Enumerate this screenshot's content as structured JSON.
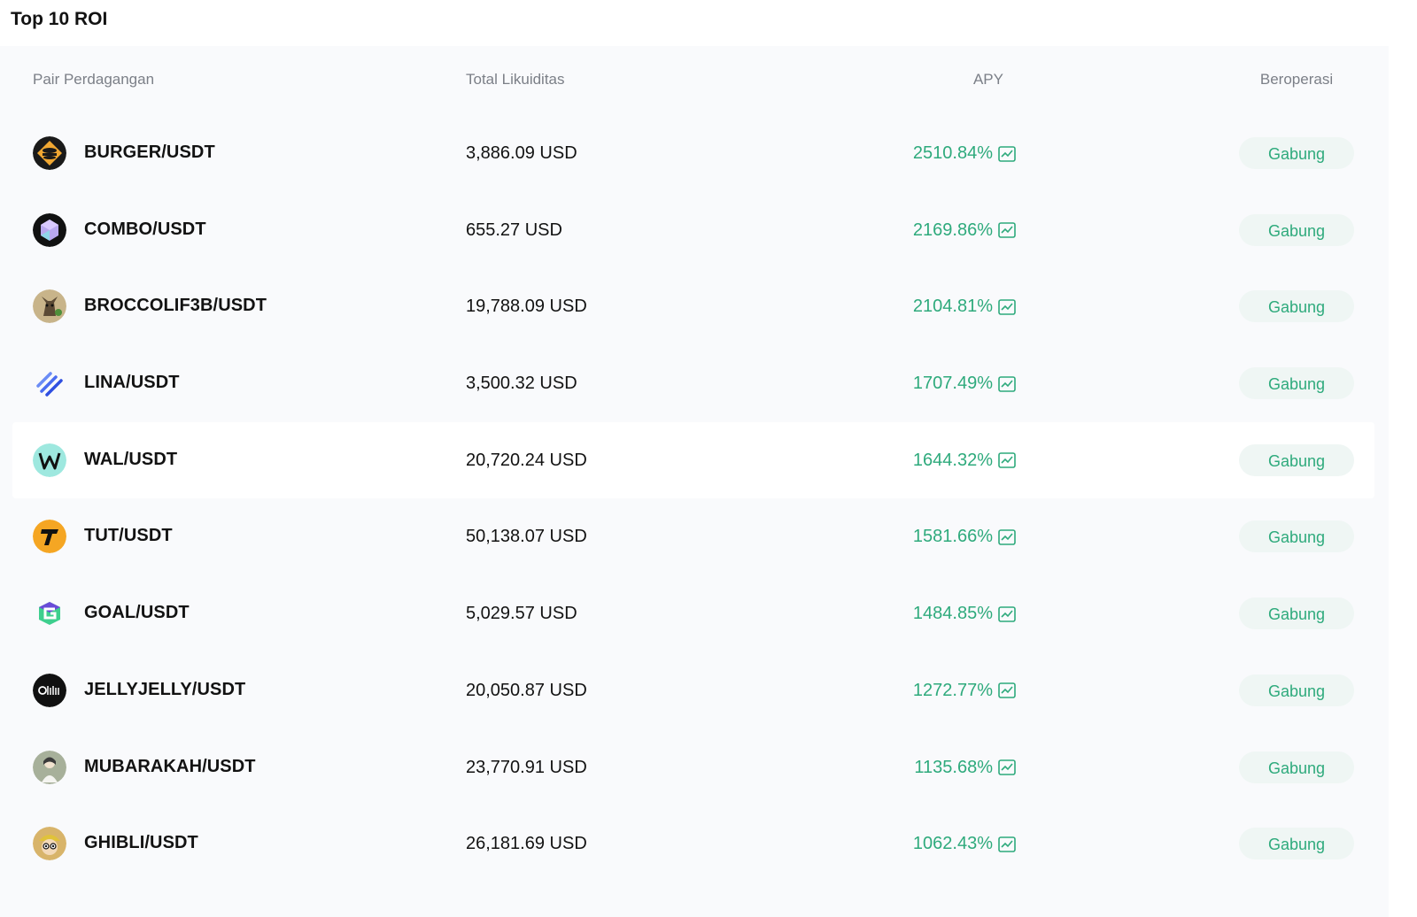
{
  "title": "Top 10 ROI",
  "headers": {
    "pair": "Pair Perdagangan",
    "liquidity": "Total Likuiditas",
    "apy": "APY",
    "operation": "Beroperasi"
  },
  "colors": {
    "accent_green": "#2eaa7c",
    "button_bg": "#eff6f4",
    "panel_bg": "#f9fafc"
  },
  "rows": [
    {
      "pair": "BURGER/USDT",
      "liquidity": "3,886.09 USD",
      "apy": "2510.84%",
      "action": "Gabung",
      "icon": "burger-coin-icon"
    },
    {
      "pair": "COMBO/USDT",
      "liquidity": "655.27 USD",
      "apy": "2169.86%",
      "action": "Gabung",
      "icon": "combo-coin-icon"
    },
    {
      "pair": "BROCCOLIF3B/USDT",
      "liquidity": "19,788.09 USD",
      "apy": "2104.81%",
      "action": "Gabung",
      "icon": "broccoli-dog-coin-icon"
    },
    {
      "pair": "LINA/USDT",
      "liquidity": "3,500.32 USD",
      "apy": "1707.49%",
      "action": "Gabung",
      "icon": "lina-coin-icon"
    },
    {
      "pair": "WAL/USDT",
      "liquidity": "20,720.24 USD",
      "apy": "1644.32%",
      "action": "Gabung",
      "icon": "wal-coin-icon"
    },
    {
      "pair": "TUT/USDT",
      "liquidity": "50,138.07 USD",
      "apy": "1581.66%",
      "action": "Gabung",
      "icon": "tut-coin-icon"
    },
    {
      "pair": "GOAL/USDT",
      "liquidity": "5,029.57 USD",
      "apy": "1484.85%",
      "action": "Gabung",
      "icon": "goal-coin-icon"
    },
    {
      "pair": "JELLYJELLY/USDT",
      "liquidity": "20,050.87 USD",
      "apy": "1272.77%",
      "action": "Gabung",
      "icon": "jelly-coin-icon"
    },
    {
      "pair": "MUBARAKAH/USDT",
      "liquidity": "23,770.91 USD",
      "apy": "1135.68%",
      "action": "Gabung",
      "icon": "mubarakah-coin-icon"
    },
    {
      "pair": "GHIBLI/USDT",
      "liquidity": "26,181.69 USD",
      "apy": "1062.43%",
      "action": "Gabung",
      "icon": "ghibli-coin-icon"
    }
  ]
}
